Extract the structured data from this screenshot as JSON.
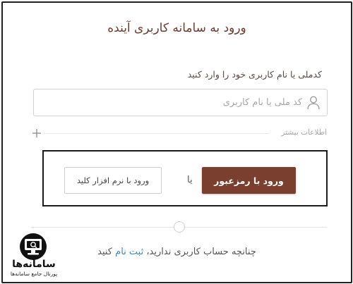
{
  "page": {
    "title": "ورود به سامانه کاربری آینده"
  },
  "username_field": {
    "label": "کدملی یا نام کاربری خود را وارد کنید",
    "placeholder": "کد ملی یا نام کاربری",
    "value": "",
    "icon": "user-icon"
  },
  "more_info": {
    "label": "اطلاعات بیشتر",
    "icon": "plus-icon"
  },
  "login_options": {
    "password_button": "ورود با رمزعبور",
    "or": "یا",
    "software_button": "ورود با نرم افزار کلید"
  },
  "signup": {
    "prefix": "چنانچه حساب کاربری ندارید،",
    "link": "ثبت نام",
    "suffix": "کنید"
  },
  "watermark": {
    "name": "سامانه‌ها",
    "tagline": "پورتال جامع سامانه‌ها"
  },
  "colors": {
    "accent": "#7a3f2e",
    "title": "#6b3c31",
    "link": "#3b87c9"
  }
}
